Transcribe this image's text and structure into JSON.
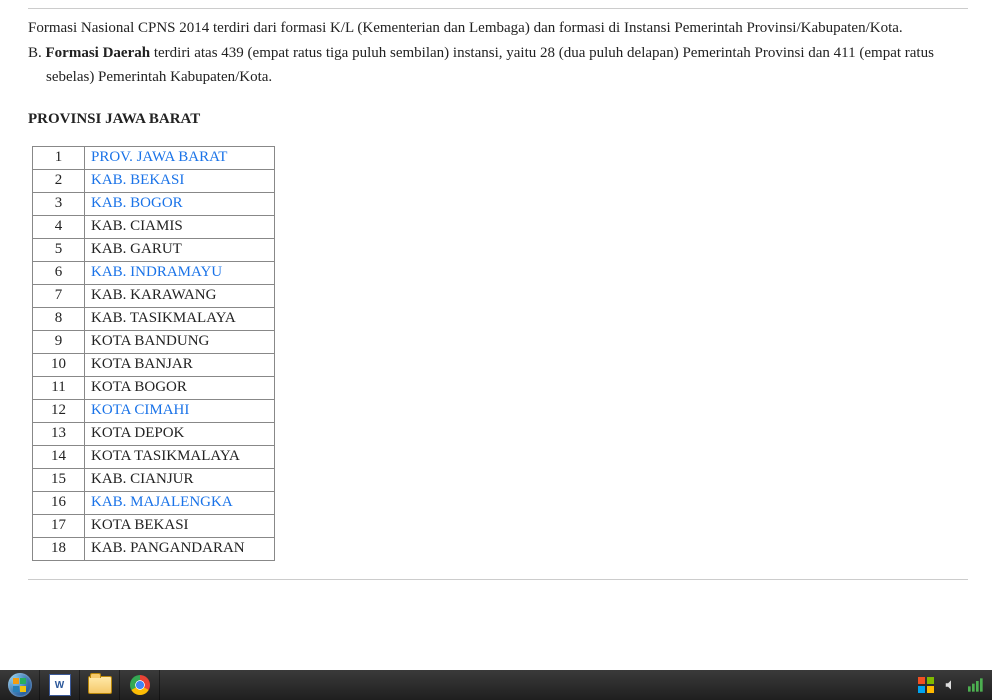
{
  "intro_text": "Formasi Nasional CPNS 2014 terdiri dari formasi K/L (Kementerian dan Lembaga) dan formasi di Instansi Pemerintah Provinsi/Kabupaten/Kota.",
  "formasi_daerah": {
    "prefix": "B",
    "label": "Formasi Daerah",
    "text_after_bold": " terdiri atas 439 (empat ratus tiga puluh sembilan) instansi, yaitu 28 (dua puluh delapan) Pemerintah Provinsi dan 411 (empat ratus",
    "text_cont": "sebelas) Pemerintah Kabupaten/Kota."
  },
  "section_title": "PROVINSI JAWA BARAT",
  "rows": [
    {
      "num": "1",
      "name": "PROV. JAWA BARAT",
      "link": true
    },
    {
      "num": "2",
      "name": "KAB. BEKASI",
      "link": true
    },
    {
      "num": "3",
      "name": "KAB. BOGOR",
      "link": true
    },
    {
      "num": "4",
      "name": "KAB. CIAMIS",
      "link": false
    },
    {
      "num": "5",
      "name": "KAB. GARUT",
      "link": false
    },
    {
      "num": "6",
      "name": "KAB. INDRAMAYU",
      "link": true
    },
    {
      "num": "7",
      "name": "KAB. KARAWANG",
      "link": false
    },
    {
      "num": "8",
      "name": "KAB. TASIKMALAYA",
      "link": false
    },
    {
      "num": "9",
      "name": "KOTA BANDUNG",
      "link": false
    },
    {
      "num": "10",
      "name": "KOTA BANJAR",
      "link": false
    },
    {
      "num": "11",
      "name": "KOTA BOGOR",
      "link": false
    },
    {
      "num": "12",
      "name": "KOTA CIMAHI",
      "link": true
    },
    {
      "num": "13",
      "name": "KOTA DEPOK",
      "link": false
    },
    {
      "num": "14",
      "name": "KOTA TASIKMALAYA",
      "link": false
    },
    {
      "num": "15",
      "name": "KAB. CIANJUR",
      "link": false
    },
    {
      "num": "16",
      "name": "KAB. MAJALENGKA",
      "link": true
    },
    {
      "num": "17",
      "name": "KOTA BEKASI",
      "link": false
    },
    {
      "num": "18",
      "name": "KAB. PANGANDARAN",
      "link": false
    }
  ],
  "colors": {
    "link": "#1a73e8"
  }
}
